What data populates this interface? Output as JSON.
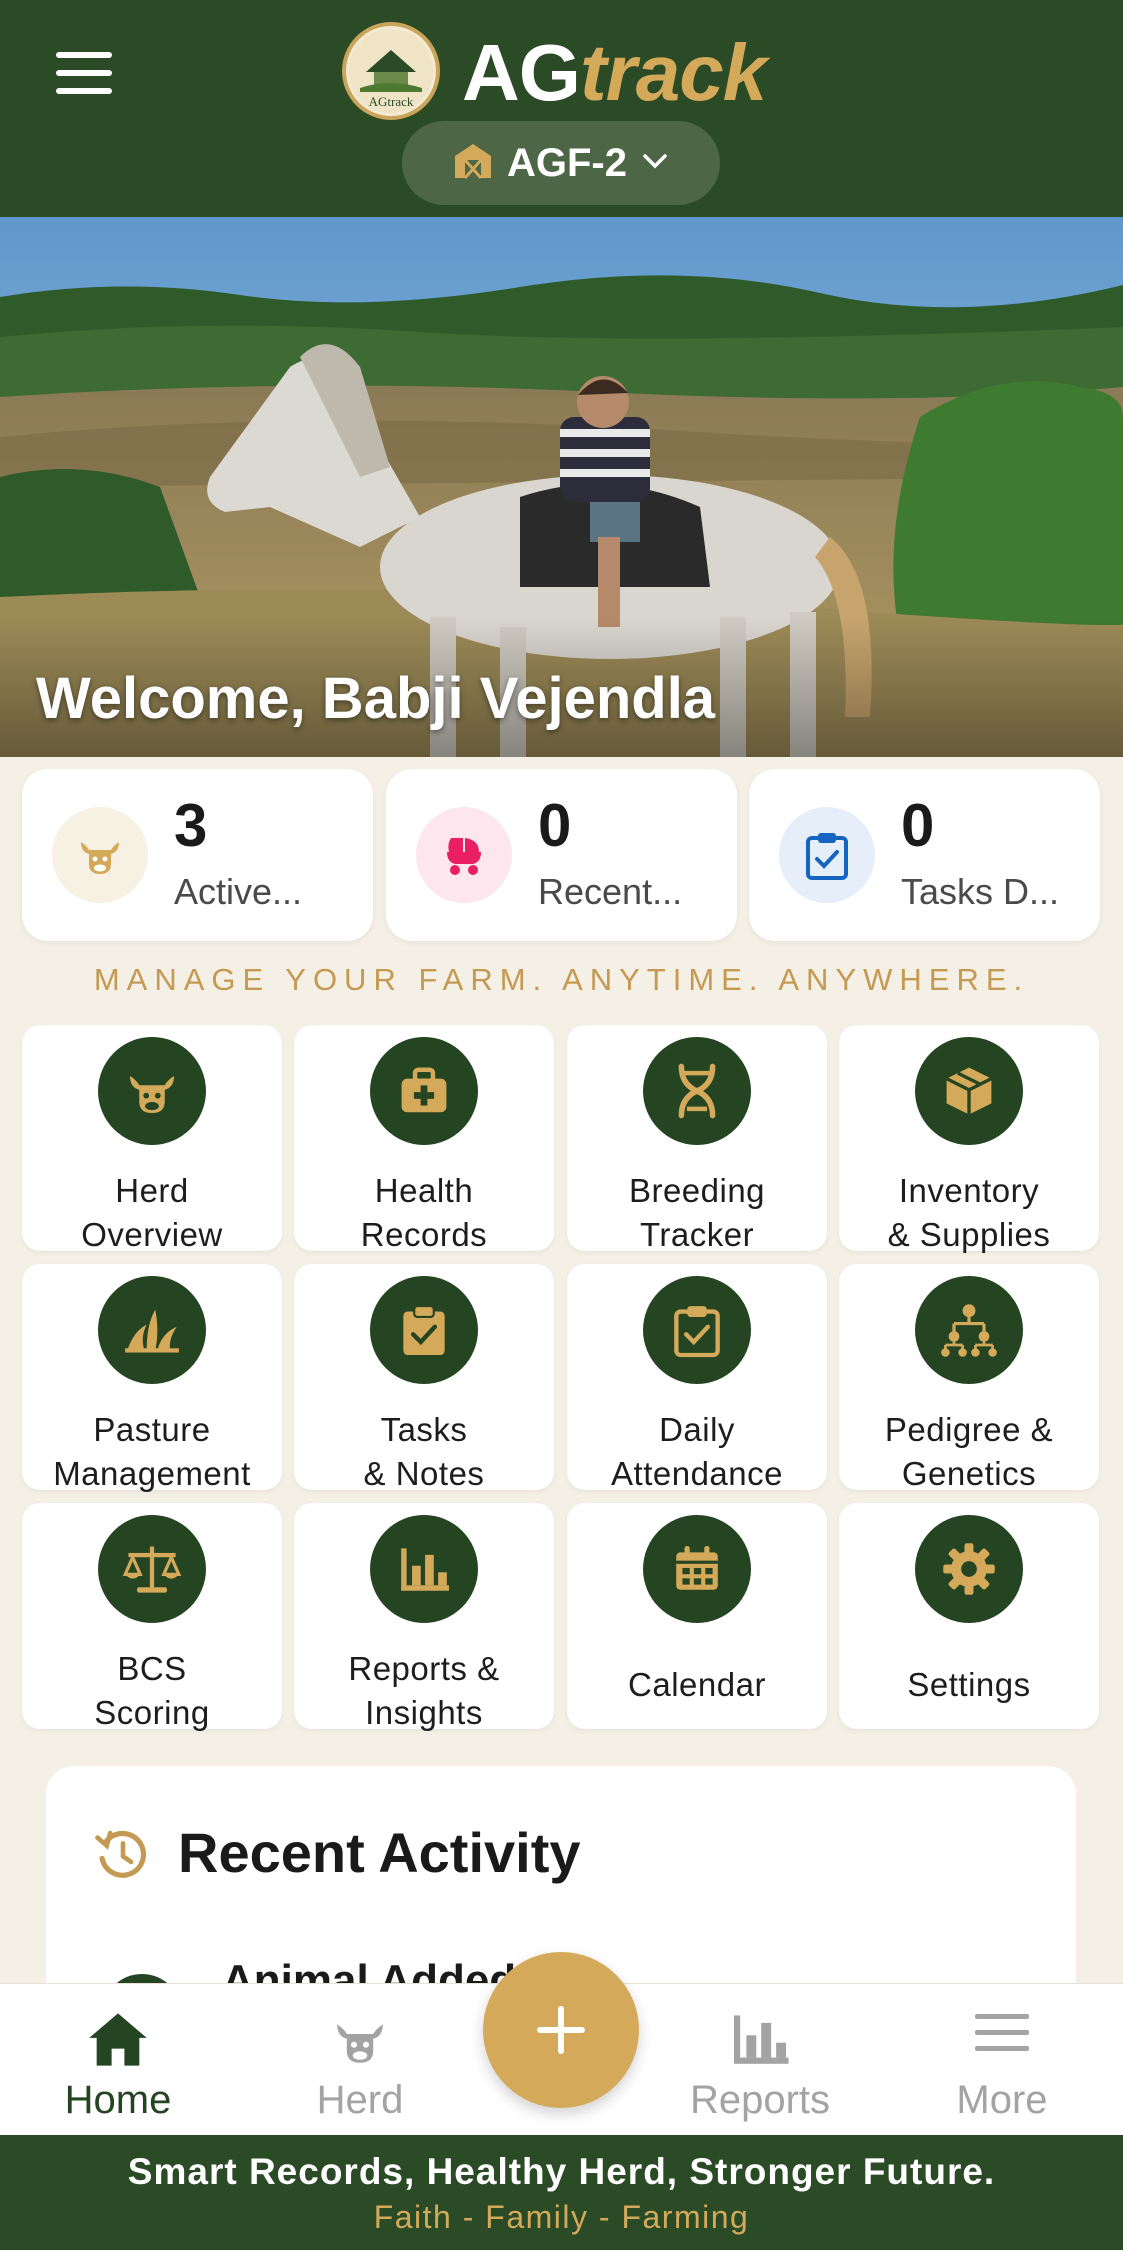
{
  "app": {
    "brand_primary": "AG",
    "brand_accent": "track",
    "logo_text": "AGtrack",
    "colors": {
      "primary": "#2b4a26",
      "accent": "#d4a95a",
      "background": "#f4f0e6"
    }
  },
  "farm_selector": {
    "label": "AGF-2",
    "icon": "barn-icon"
  },
  "hero": {
    "welcome": "Welcome, Babji Vejendla"
  },
  "stats": [
    {
      "value": "3",
      "label": "Active...",
      "icon": "cow-icon"
    },
    {
      "value": "0",
      "label": "Recent...",
      "icon": "stroller-icon"
    },
    {
      "value": "0",
      "label": "Tasks D...",
      "icon": "clipboard-check-icon"
    }
  ],
  "tagline": "MANAGE YOUR FARM. ANYTIME. ANYWHERE.",
  "tiles": [
    {
      "line1": "Herd",
      "line2": "Overview",
      "icon": "cow-icon"
    },
    {
      "line1": "Health",
      "line2": "Records",
      "icon": "medical-bag-icon"
    },
    {
      "line1": "Breeding",
      "line2": "Tracker",
      "icon": "dna-icon"
    },
    {
      "line1": "Inventory",
      "line2": "& Supplies",
      "icon": "box-icon"
    },
    {
      "line1": "Pasture",
      "line2": "Management",
      "icon": "grass-icon"
    },
    {
      "line1": "Tasks",
      "line2": "& Notes",
      "icon": "clipboard-check-icon"
    },
    {
      "line1": "Daily",
      "line2": "Attendance",
      "icon": "clipboard-check-icon"
    },
    {
      "line1": "Pedigree &",
      "line2": "Genetics",
      "icon": "family-tree-icon"
    },
    {
      "line1": "BCS",
      "line2": "Scoring",
      "icon": "scale-icon"
    },
    {
      "line1": "Reports &",
      "line2": "Insights",
      "icon": "bar-chart-icon"
    },
    {
      "line1": "Calendar",
      "line2": "",
      "icon": "calendar-icon"
    },
    {
      "line1": "Settings",
      "line2": "",
      "icon": "gear-icon"
    }
  ],
  "recent_activity": {
    "title": "Recent Activity",
    "first_item": "Animal Added"
  },
  "bottom_nav": [
    {
      "label": "Home",
      "icon": "home-icon",
      "active": true
    },
    {
      "label": "Herd",
      "icon": "cow-icon",
      "active": false
    },
    {
      "label": "Reports",
      "icon": "bar-chart-icon",
      "active": false
    },
    {
      "label": "More",
      "icon": "menu-icon",
      "active": false
    }
  ],
  "footer": {
    "slogan": "Smart Records, Healthy Herd, Stronger Future.",
    "motto": "Faith - Family - Farming"
  }
}
